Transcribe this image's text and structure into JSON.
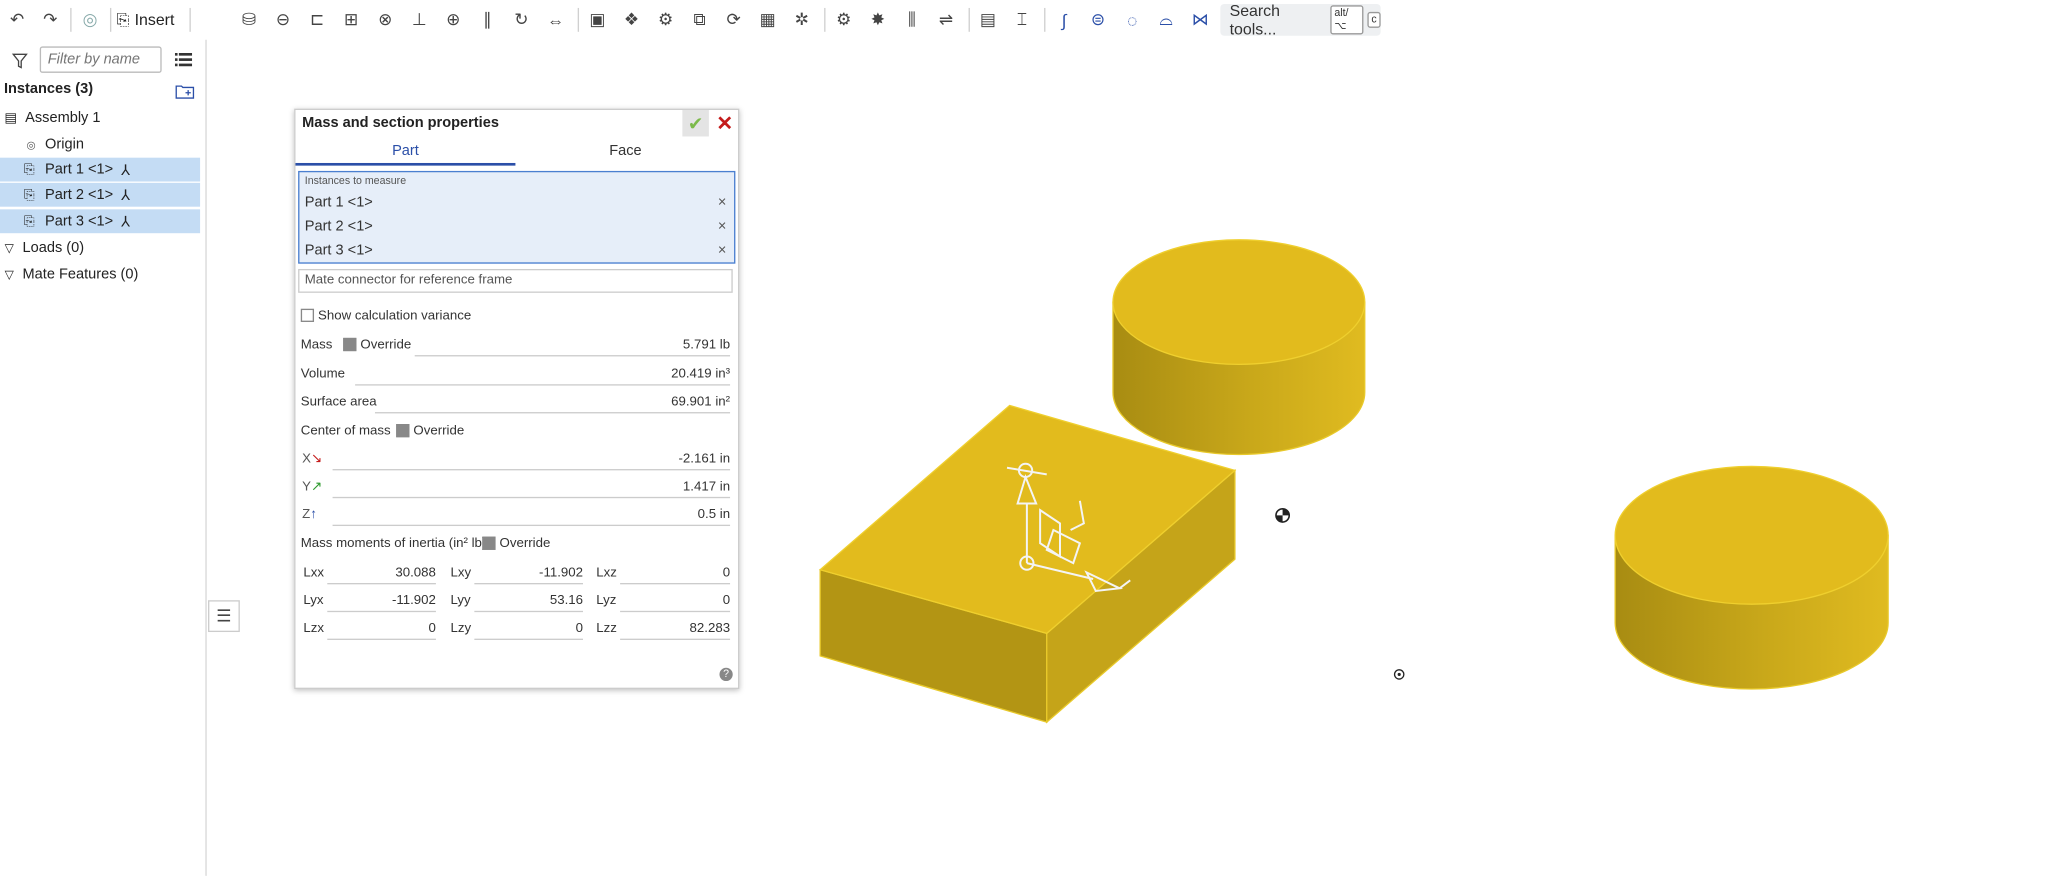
{
  "toolbar": {
    "insert_label": "Insert",
    "search_label": "Search tools...",
    "search_shortcut_1": "alt/⌥",
    "search_shortcut_2": "c",
    "icons": [
      "undo-icon",
      "redo-icon",
      "mate-connector-icon",
      "insert-icon",
      "fastened-mate-icon",
      "revolute-mate-icon",
      "slider-mate-icon",
      "planar-mate-icon",
      "cylindrical-mate-icon",
      "pin-slot-mate-icon",
      "ball-mate-icon",
      "parallel-mate-icon",
      "tangent-mate-icon",
      "width-mate-icon",
      "group-icon",
      "replicate-icon",
      "mate-features-icon",
      "linear-pattern-icon",
      "circular-pattern-icon",
      "pattern-icon",
      "explode-icon",
      "gear-relation-icon",
      "rack-pinion-icon",
      "screw-relation-icon",
      "linear-relation-icon",
      "section-view-icon",
      "measure-icon",
      "routing-curve-icon",
      "loop-icon",
      "ring-icon",
      "cam-icon",
      "mirror-icon"
    ]
  },
  "sidebar": {
    "filter_placeholder": "Filter by name",
    "instances_header": "Instances (3)",
    "items": [
      {
        "label": "Assembly 1",
        "selected": false
      },
      {
        "label": "Origin",
        "selected": false
      },
      {
        "label": "Part 1 <1>",
        "selected": true
      },
      {
        "label": "Part 2 <1>",
        "selected": true
      },
      {
        "label": "Part 3 <1>",
        "selected": true
      }
    ],
    "loads_label": "Loads (0)",
    "mate_features_label": "Mate Features (0)"
  },
  "panel": {
    "title": "Mass and section properties",
    "tabs": [
      "Part",
      "Face"
    ],
    "active_tab": "Part",
    "instances_caption": "Instances to measure",
    "instances": [
      "Part 1 <1>",
      "Part 2 <1>",
      "Part 3 <1>"
    ],
    "remove_symbol": "×",
    "mate_connector_placeholder": "Mate connector for reference frame",
    "show_variance_label": "Show calculation variance",
    "mass_label": "Mass",
    "override_label": "Override",
    "mass_value": "5.791 lb",
    "volume_label": "Volume",
    "volume_value": "20.419 in³",
    "surface_label": "Surface area",
    "surface_value": "69.901 in²",
    "com_label": "Center of mass",
    "com": [
      {
        "axis": "X",
        "arrow": "↘",
        "color": "#c41b1b",
        "value": "-2.161 in"
      },
      {
        "axis": "Y",
        "arrow": "↗",
        "color": "#2e9a2e",
        "value": "1.417 in"
      },
      {
        "axis": "Z",
        "arrow": "↑",
        "color": "#2b4fa8",
        "value": "0.5 in"
      }
    ],
    "moi_label": "Mass moments of inertia (in² lb)",
    "moi": [
      [
        {
          "k": "Lxx",
          "v": "30.088"
        },
        {
          "k": "Lxy",
          "v": "-11.902"
        },
        {
          "k": "Lxz",
          "v": "0"
        }
      ],
      [
        {
          "k": "Lyx",
          "v": "-11.902"
        },
        {
          "k": "Lyy",
          "v": "53.16"
        },
        {
          "k": "Lyz",
          "v": "0"
        }
      ],
      [
        {
          "k": "Lzx",
          "v": "0"
        },
        {
          "k": "Lzy",
          "v": "0"
        },
        {
          "k": "Lzz",
          "v": "82.283"
        }
      ]
    ],
    "help_symbol": "?"
  },
  "colors": {
    "part_top": "#e2bb1d",
    "part_side_dark": "#a88c12",
    "selection": "#c4dcf4",
    "accent": "#2b4fa8"
  }
}
